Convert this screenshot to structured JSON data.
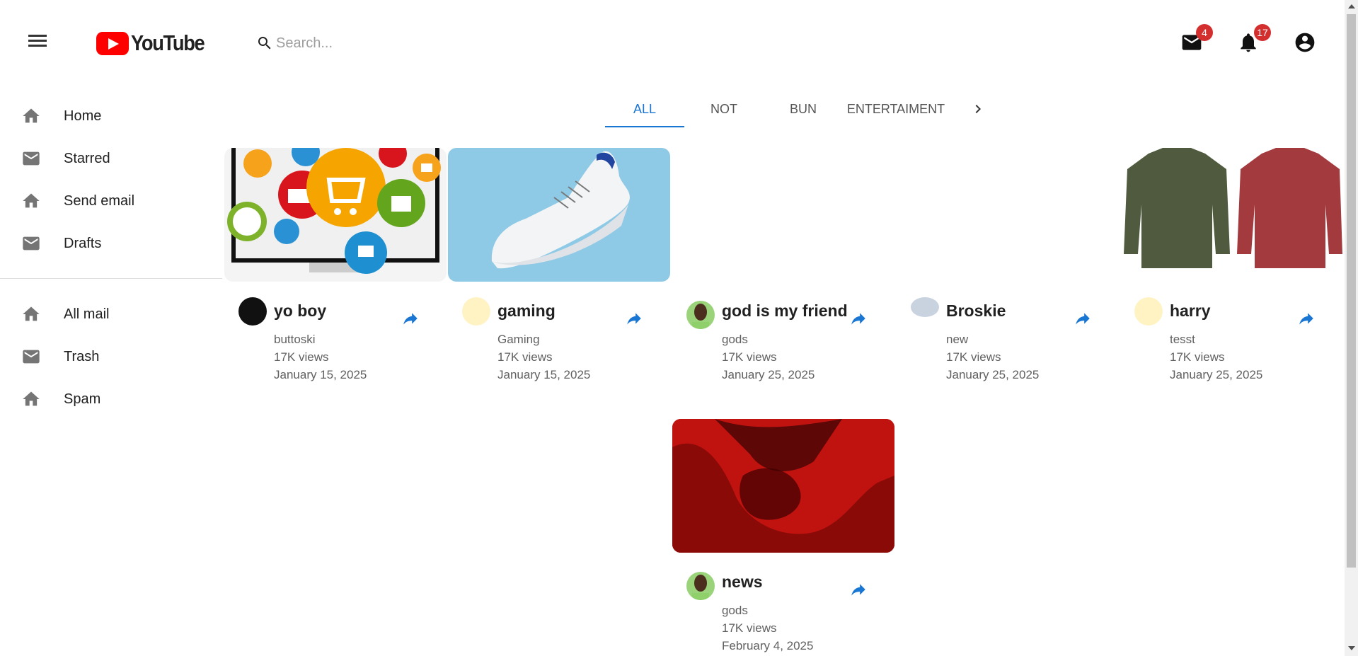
{
  "header": {
    "logo_text": "YouTube",
    "search_placeholder": "Search...",
    "mail_badge": "4",
    "notifications_badge": "17"
  },
  "sidebar": {
    "items": [
      {
        "label": "Home",
        "icon": "home-icon"
      },
      {
        "label": "Starred",
        "icon": "mail-icon"
      },
      {
        "label": "Send email",
        "icon": "home-icon"
      },
      {
        "label": "Drafts",
        "icon": "mail-icon"
      },
      {
        "label": "All mail",
        "icon": "home-icon"
      },
      {
        "label": "Trash",
        "icon": "mail-icon"
      },
      {
        "label": "Spam",
        "icon": "home-icon"
      }
    ]
  },
  "tabs": [
    {
      "label": "ALL",
      "active": true
    },
    {
      "label": "NOT",
      "active": false
    },
    {
      "label": "BUN",
      "active": false
    },
    {
      "label": "ENTERTAIMENT",
      "active": false
    }
  ],
  "videos": [
    {
      "title": "yo boy",
      "channel": "buttoski",
      "views": "17K views",
      "date": "January 15, 2025",
      "thumbnail": "shopping-icons-thumbnail"
    },
    {
      "title": "gaming",
      "channel": "Gaming",
      "views": "17K views",
      "date": "January 15, 2025",
      "thumbnail": "white-sneaker-thumbnail"
    },
    {
      "title": "god is my friend",
      "channel": "gods",
      "views": "17K views",
      "date": "January 25, 2025",
      "thumbnail": "blank-thumbnail"
    },
    {
      "title": "Broskie",
      "channel": "new",
      "views": "17K views",
      "date": "January 25, 2025",
      "thumbnail": "blank-thumbnail"
    },
    {
      "title": "harry",
      "channel": "tesst",
      "views": "17K views",
      "date": "January 25, 2025",
      "thumbnail": "plaid-shirts-thumbnail"
    },
    {
      "title": "news",
      "channel": "gods",
      "views": "17K views",
      "date": "February 4, 2025",
      "thumbnail": "red-demon-thumbnail"
    }
  ],
  "colors": {
    "accent": "#1976d2",
    "badge": "#d32f2f",
    "brand_red": "#ff0000"
  }
}
